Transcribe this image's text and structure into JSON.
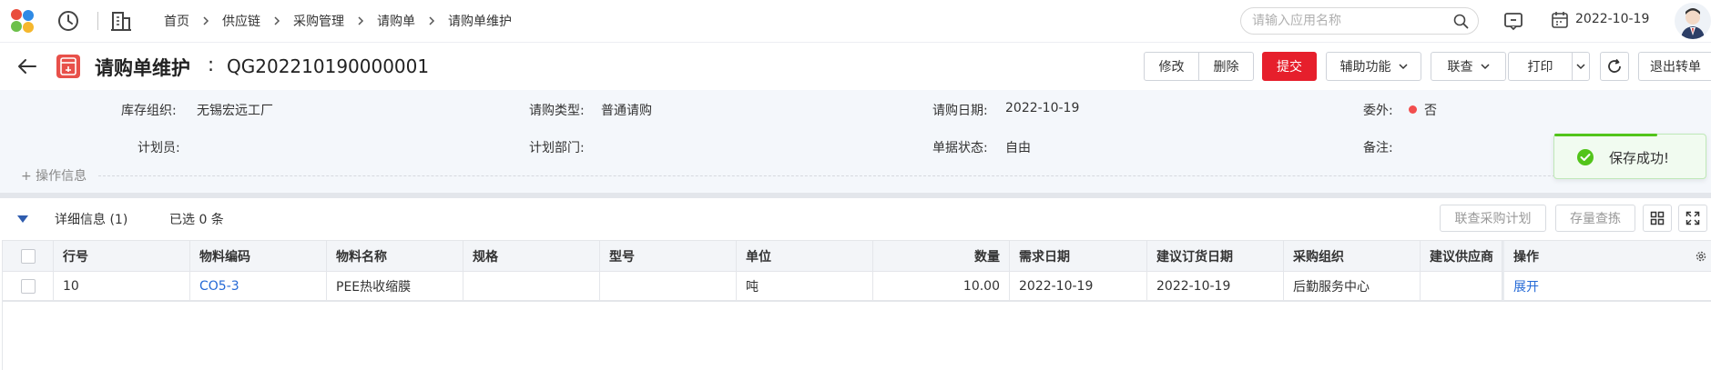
{
  "topnav": {
    "breadcrumb": [
      "首页",
      "供应链",
      "采购管理",
      "请购单",
      "请购单维护"
    ],
    "search_placeholder": "请输入应用名称",
    "date": "2022-10-19"
  },
  "titlebar": {
    "title": "请购单维护",
    "colon": ":",
    "doc_no": "QG202210190000001",
    "buttons": {
      "edit": "修改",
      "delete": "删除",
      "submit": "提交",
      "assist": "辅助功能",
      "link": "联查",
      "print": "打印",
      "exit": "退出转单"
    }
  },
  "form": {
    "org_label": "库存组织:",
    "org_value": "无锡宏远工厂",
    "type_label": "请购类型:",
    "type_value": "普通请购",
    "date_label": "请购日期:",
    "date_value": "2022-10-19",
    "outsource_label": "委外:",
    "outsource_value": "否",
    "planner_label": "计划员:",
    "planner_value": "",
    "dept_label": "计划部门:",
    "dept_value": "",
    "status_label": "单据状态:",
    "status_value": "自由",
    "remark_label": "备注:",
    "remark_value": "",
    "op_info": "+ 操作信息"
  },
  "toast": {
    "text": "保存成功!"
  },
  "detail": {
    "title": "详细信息 (1)",
    "selected": "已选 0 条",
    "btn_plan": "联查采购计划",
    "btn_stock": "存量查拣"
  },
  "table": {
    "columns": [
      "行号",
      "物料编码",
      "物料名称",
      "规格",
      "型号",
      "单位",
      "数量",
      "需求日期",
      "建议订货日期",
      "采购组织",
      "建议供应商",
      "操作"
    ],
    "rows": [
      {
        "line": "10",
        "code": "CO5-3",
        "name": "PEE热收缩膜",
        "spec": "",
        "model": "",
        "unit": "吨",
        "qty": "10.00",
        "need_date": "2022-10-19",
        "order_date": "2022-10-19",
        "org": "后勤服务中心",
        "supplier": "",
        "action": "展开"
      }
    ]
  },
  "colors": {
    "primary": "#e61f2c",
    "link": "#2469d6",
    "success": "#52c41a",
    "form_bg": "#f4f7fb"
  }
}
